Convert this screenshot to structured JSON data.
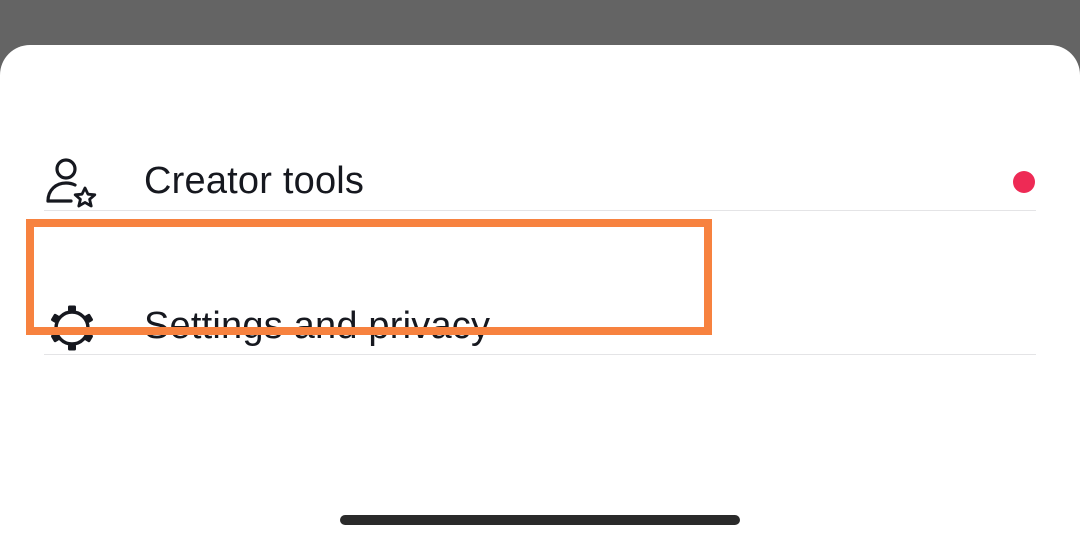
{
  "menu": {
    "items": [
      {
        "label": "Creator tools",
        "icon": "creator-tools-icon",
        "has_notification": true
      },
      {
        "label": "Settings and privacy",
        "icon": "gear-icon",
        "highlighted": true
      }
    ]
  },
  "colors": {
    "notification_dot": "#ee2a55",
    "highlight_border": "#f7823f",
    "backdrop": "#646464",
    "sheet": "#ffffff",
    "text": "#16181f",
    "divider": "#e4e4e6"
  }
}
